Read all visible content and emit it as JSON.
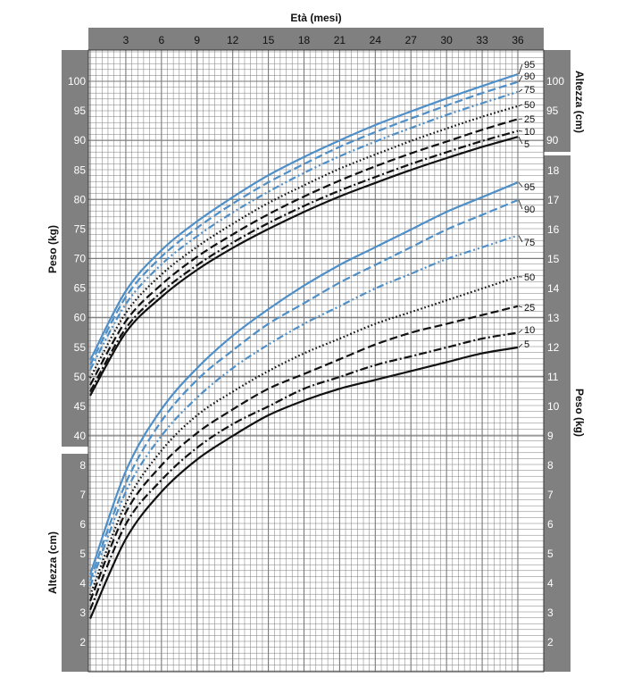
{
  "chart_data": {
    "type": "line",
    "title": "",
    "xlabel": "Età (mesi)",
    "x_ticks": [
      "3",
      "6",
      "9",
      "12",
      "15",
      "18",
      "21",
      "24",
      "27",
      "30",
      "33",
      "36"
    ],
    "xlim": [
      0,
      36
    ],
    "left_upper_label": "Peso (kg)",
    "left_upper_ticks": [
      "40",
      "45",
      "50",
      "55",
      "60",
      "65",
      "70",
      "75",
      "80",
      "85",
      "90",
      "95",
      "100"
    ],
    "left_lower_label": "Altezza (cm)",
    "left_lower_ticks": [
      "2",
      "3",
      "4",
      "5",
      "6",
      "7",
      "8"
    ],
    "right_upper_label": "Altezza (cm)",
    "right_upper_ticks": [
      "90",
      "95",
      "100"
    ],
    "right_lower_label": "Peso (kg)",
    "right_lower_ticks": [
      "2",
      "3",
      "4",
      "5",
      "6",
      "7",
      "8",
      "9",
      "10",
      "11",
      "12",
      "13",
      "14",
      "15",
      "16",
      "17",
      "18"
    ],
    "colors": {
      "panel": "#808080",
      "grid": "#7a7a7a",
      "blue": "#4f8fc8",
      "black": "#111111"
    },
    "percentile_labels": [
      "95",
      "90",
      "75",
      "50",
      "25",
      "10",
      "5"
    ],
    "height_percentiles": {
      "x": [
        0,
        3,
        6,
        9,
        12,
        15,
        18,
        21,
        24,
        27,
        30,
        33,
        36
      ],
      "unit": "cm",
      "series": [
        {
          "name": "95",
          "values": [
            52.8,
            64.5,
            71.4,
            76.3,
            80.4,
            84.1,
            87.2,
            90.0,
            92.6,
            94.9,
            97.1,
            99.2,
            101.2
          ],
          "color": "#4f8fc8",
          "style": "solid"
        },
        {
          "name": "90",
          "values": [
            52.0,
            63.5,
            70.3,
            75.2,
            79.3,
            82.9,
            86.0,
            88.9,
            91.4,
            93.7,
            95.9,
            98.0,
            99.9
          ],
          "color": "#4f8fc8",
          "style": "dashed"
        },
        {
          "name": "75",
          "values": [
            51.2,
            62.3,
            69.0,
            73.8,
            77.8,
            81.3,
            84.5,
            87.3,
            89.8,
            92.1,
            94.3,
            96.3,
            98.2
          ],
          "color": "#4f8fc8",
          "style": "dashdotdot"
        },
        {
          "name": "50",
          "values": [
            49.8,
            60.8,
            67.3,
            72.0,
            75.9,
            79.4,
            82.4,
            85.2,
            87.6,
            89.9,
            92.0,
            94.0,
            95.8
          ],
          "color": "#111111",
          "style": "dotted"
        },
        {
          "name": "25",
          "values": [
            48.6,
            59.4,
            65.6,
            70.3,
            74.1,
            77.5,
            80.5,
            83.2,
            85.6,
            87.8,
            89.8,
            91.8,
            93.6
          ],
          "color": "#111111",
          "style": "dashed"
        },
        {
          "name": "10",
          "values": [
            47.5,
            58.2,
            64.3,
            68.9,
            72.7,
            76.0,
            78.9,
            81.5,
            83.8,
            86.0,
            88.0,
            89.9,
            91.6
          ],
          "color": "#111111",
          "style": "dashdot"
        },
        {
          "name": "5",
          "values": [
            46.8,
            57.5,
            63.5,
            68.1,
            71.8,
            75.0,
            77.9,
            80.5,
            82.8,
            85.0,
            87.0,
            88.9,
            90.6
          ],
          "color": "#111111",
          "style": "solid"
        }
      ]
    },
    "weight_percentiles": {
      "x": [
        0,
        3,
        6,
        9,
        12,
        15,
        18,
        21,
        24,
        27,
        30,
        33,
        36
      ],
      "unit": "kg",
      "series": [
        {
          "name": "95",
          "values": [
            4.3,
            7.8,
            9.9,
            11.3,
            12.4,
            13.3,
            14.1,
            14.8,
            15.4,
            16.0,
            16.6,
            17.1,
            17.6
          ],
          "color": "#4f8fc8",
          "style": "solid"
        },
        {
          "name": "90",
          "values": [
            4.1,
            7.4,
            9.5,
            10.9,
            11.9,
            12.8,
            13.5,
            14.2,
            14.8,
            15.4,
            16.0,
            16.5,
            17.0
          ],
          "color": "#4f8fc8",
          "style": "dashed"
        },
        {
          "name": "75",
          "values": [
            3.9,
            7.1,
            9.0,
            10.3,
            11.3,
            12.1,
            12.8,
            13.4,
            14.0,
            14.5,
            15.0,
            15.4,
            15.8
          ],
          "color": "#4f8fc8",
          "style": "dashdotdot"
        },
        {
          "name": "50",
          "values": [
            3.6,
            6.7,
            8.5,
            9.7,
            10.5,
            11.2,
            11.8,
            12.3,
            12.8,
            13.2,
            13.6,
            14.0,
            14.4
          ],
          "color": "#111111",
          "style": "dotted"
        },
        {
          "name": "25",
          "values": [
            3.4,
            6.4,
            8.0,
            9.1,
            9.9,
            10.6,
            11.1,
            11.6,
            12.1,
            12.5,
            12.8,
            13.1,
            13.4
          ],
          "color": "#111111",
          "style": "dashed"
        },
        {
          "name": "10",
          "values": [
            3.1,
            6.0,
            7.5,
            8.6,
            9.4,
            10.0,
            10.6,
            11.0,
            11.4,
            11.7,
            12.0,
            12.3,
            12.5
          ],
          "color": "#111111",
          "style": "dashdot"
        },
        {
          "name": "5",
          "values": [
            2.8,
            5.5,
            7.1,
            8.2,
            9.0,
            9.7,
            10.2,
            10.6,
            10.9,
            11.2,
            11.5,
            11.8,
            12.0
          ],
          "color": "#111111",
          "style": "solid"
        }
      ]
    }
  }
}
